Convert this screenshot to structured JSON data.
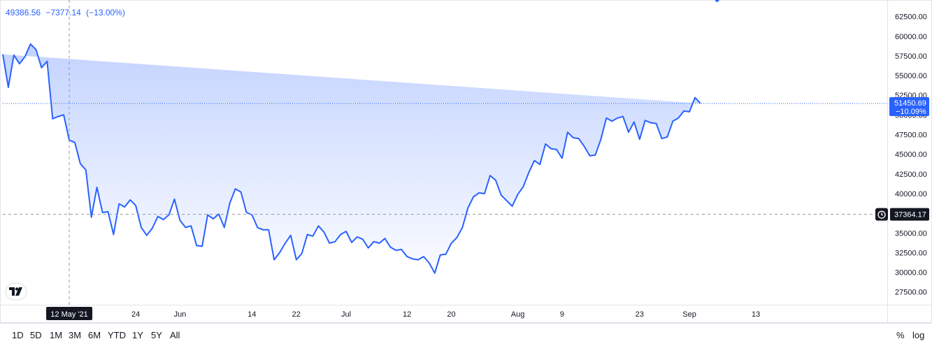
{
  "legend": {
    "price": "49386.56",
    "change": "−7377.14",
    "change_pct": "(−13.00%)"
  },
  "crosshair": {
    "date_label": "12 May '21",
    "price_label": "37364.17",
    "price": 37364.17
  },
  "last_price": {
    "price_label": "51450.69",
    "pct_label": "−10.09%",
    "price": 51450.69
  },
  "colors": {
    "line": "#2962ff",
    "label_bg": "#2962ff",
    "crosshair_label_bg": "#131722"
  },
  "ranges": [
    "1D",
    "5D",
    "1M",
    "3M",
    "6M",
    "YTD",
    "1Y",
    "5Y",
    "All"
  ],
  "scale": {
    "percent": "%",
    "log": "log"
  },
  "chart_data": {
    "type": "area",
    "ylim": [
      26500,
      63000
    ],
    "yticks": [
      "62500.00",
      "60000.00",
      "57500.00",
      "55000.00",
      "52500.00",
      "50000.00",
      "47500.00",
      "45000.00",
      "42500.00",
      "40000.00",
      "37500.00",
      "35000.00",
      "32500.00",
      "30000.00",
      "27500.00"
    ],
    "xticks": [
      "24",
      "Jun",
      "14",
      "22",
      "Jul",
      "12",
      "20",
      "Aug",
      "9",
      "23",
      "Sep",
      "13"
    ],
    "x": [
      "2021-04-30",
      "2021-05-01",
      "2021-05-02",
      "2021-05-03",
      "2021-05-04",
      "2021-05-05",
      "2021-05-06",
      "2021-05-07",
      "2021-05-08",
      "2021-05-09",
      "2021-05-10",
      "2021-05-11",
      "2021-05-12",
      "2021-05-13",
      "2021-05-14",
      "2021-05-15",
      "2021-05-16",
      "2021-05-17",
      "2021-05-18",
      "2021-05-19",
      "2021-05-20",
      "2021-05-21",
      "2021-05-22",
      "2021-05-23",
      "2021-05-24",
      "2021-05-25",
      "2021-05-26",
      "2021-05-27",
      "2021-05-28",
      "2021-05-29",
      "2021-05-30",
      "2021-05-31",
      "2021-06-01",
      "2021-06-02",
      "2021-06-03",
      "2021-06-04",
      "2021-06-05",
      "2021-06-06",
      "2021-06-07",
      "2021-06-08",
      "2021-06-09",
      "2021-06-10",
      "2021-06-11",
      "2021-06-12",
      "2021-06-13",
      "2021-06-14",
      "2021-06-15",
      "2021-06-16",
      "2021-06-17",
      "2021-06-18",
      "2021-06-19",
      "2021-06-20",
      "2021-06-21",
      "2021-06-22",
      "2021-06-23",
      "2021-06-24",
      "2021-06-25",
      "2021-06-26",
      "2021-06-27",
      "2021-06-28",
      "2021-06-29",
      "2021-06-30",
      "2021-07-01",
      "2021-07-02",
      "2021-07-03",
      "2021-07-04",
      "2021-07-05",
      "2021-07-06",
      "2021-07-07",
      "2021-07-08",
      "2021-07-09",
      "2021-07-10",
      "2021-07-11",
      "2021-07-12",
      "2021-07-13",
      "2021-07-14",
      "2021-07-15",
      "2021-07-16",
      "2021-07-17",
      "2021-07-18",
      "2021-07-19",
      "2021-07-20",
      "2021-07-21",
      "2021-07-22",
      "2021-07-23",
      "2021-07-24",
      "2021-07-25",
      "2021-07-26",
      "2021-07-27",
      "2021-07-28",
      "2021-07-29",
      "2021-07-30",
      "2021-07-31",
      "2021-08-01",
      "2021-08-02",
      "2021-08-03",
      "2021-08-04",
      "2021-08-05",
      "2021-08-06",
      "2021-08-07",
      "2021-08-08",
      "2021-08-09",
      "2021-08-10",
      "2021-08-11",
      "2021-08-12",
      "2021-08-13",
      "2021-08-14",
      "2021-08-15",
      "2021-08-16",
      "2021-08-17",
      "2021-08-18",
      "2021-08-19",
      "2021-08-20",
      "2021-08-21",
      "2021-08-22",
      "2021-08-23",
      "2021-08-24",
      "2021-08-25",
      "2021-08-26",
      "2021-08-27",
      "2021-08-28",
      "2021-08-29",
      "2021-08-30",
      "2021-08-31",
      "2021-09-01",
      "2021-09-02",
      "2021-09-03",
      "2021-09-04",
      "2021-09-05",
      "2021-09-06"
    ],
    "values": [
      57700,
      53500,
      57600,
      56500,
      57400,
      59000,
      58300,
      56000,
      56800,
      49500,
      49800,
      50000,
      46800,
      46500,
      43800,
      43000,
      37000,
      40800,
      37600,
      37700,
      34800,
      38700,
      38300,
      39200,
      38500,
      35700,
      34700,
      35600,
      37100,
      36700,
      37300,
      39300,
      36600,
      35700,
      35900,
      33400,
      33300,
      37300,
      36800,
      37400,
      35700,
      38800,
      40600,
      40200,
      37600,
      37300,
      35700,
      35400,
      35400,
      31600,
      32500,
      33700,
      34700,
      31600,
      32400,
      34800,
      34600,
      35900,
      35100,
      33700,
      33900,
      34800,
      35200,
      33800,
      34500,
      34200,
      33100,
      33900,
      33700,
      34300,
      33200,
      32800,
      32900,
      32000,
      31700,
      31600,
      32000,
      31200,
      29900,
      32200,
      32300,
      33700,
      34400,
      35700,
      38200,
      39600,
      40100,
      40000,
      42300,
      41700,
      39800,
      39100,
      38400,
      39900,
      40900,
      42700,
      44200,
      43700,
      46300,
      45700,
      45600,
      44500,
      47800,
      47100,
      47000,
      46000,
      44800,
      44900,
      46900,
      49600,
      49200,
      49600,
      49800,
      47800,
      49100,
      46900,
      49300,
      49000,
      48900,
      47000,
      47200,
      49200,
      49600,
      50500,
      50400,
      52200,
      51450.69
    ]
  }
}
